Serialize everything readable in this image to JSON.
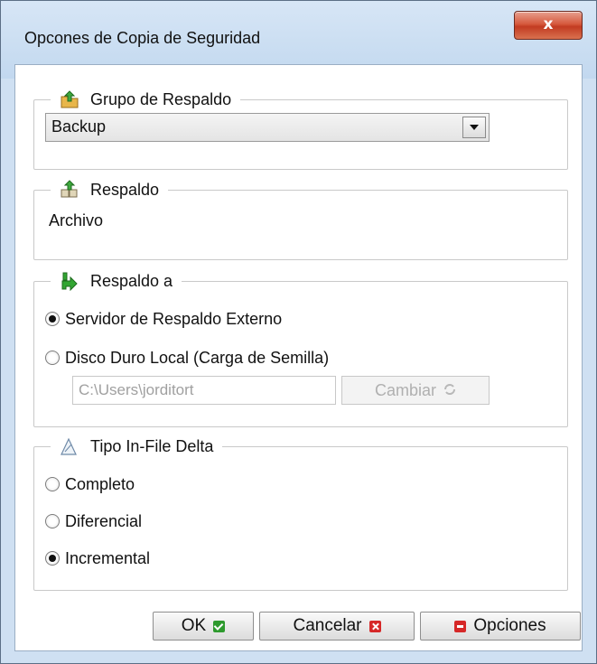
{
  "window": {
    "title": "Opcones de Copia de Seguridad",
    "close_glyph": "x"
  },
  "backup_group": {
    "legend": "Grupo de Respaldo",
    "icon": "folder-up-icon",
    "selected": "Backup"
  },
  "backup_source": {
    "legend": "Respaldo",
    "icon": "boxes-up-icon",
    "value": "Archivo"
  },
  "backup_to": {
    "legend": "Respaldo a",
    "icon": "green-arrow-icon",
    "options": [
      {
        "label": "Servidor de Respaldo Externo",
        "checked": true
      },
      {
        "label": "Disco Duro Local (Carga de Semilla)",
        "checked": false
      }
    ],
    "path_value": "C:\\Users\\jorditort",
    "change_label": "Cambiar"
  },
  "delta_type": {
    "legend": "Tipo In-File Delta",
    "icon": "delta-icon",
    "options": [
      {
        "label": "Completo",
        "checked": false
      },
      {
        "label": "Diferencial",
        "checked": false
      },
      {
        "label": "Incremental",
        "checked": true
      }
    ]
  },
  "buttons": {
    "ok": "OK",
    "cancel": "Cancelar",
    "options": "Opciones"
  }
}
